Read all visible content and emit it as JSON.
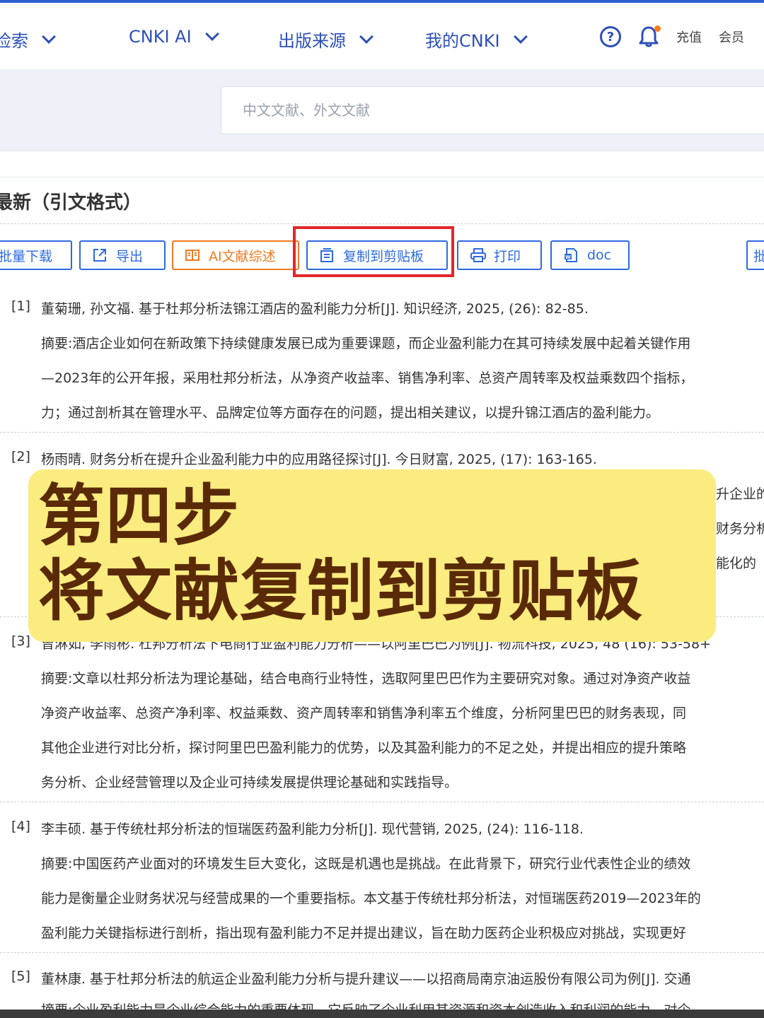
{
  "nav": {
    "items": [
      {
        "label": "检索"
      },
      {
        "label": "CNKI AI"
      },
      {
        "label": "出版来源"
      },
      {
        "label": "我的CNKI"
      }
    ],
    "help": "?",
    "recharge": "充值",
    "member": "会员"
  },
  "search": {
    "placeholder": "中文文献、外文文献"
  },
  "section": {
    "title": "最新（引文格式）"
  },
  "toolbar": {
    "batch_download": "批量下载",
    "export": "导出",
    "ai_review": "AI文献综述",
    "copy_clipboard": "复制到剪贴板",
    "print": "打印",
    "doc": "doc",
    "more": "批"
  },
  "references": [
    {
      "num": "[1]",
      "title": "董菊珊, 孙文福. 基于杜邦分析法锦江酒店的盈利能力分析[J]. 知识经济, 2025, (26): 82-85.",
      "abstract": [
        "摘要:酒店企业如何在新政策下持续健康发展已成为重要课题，而企业盈利能力在其可持续发展中起着关键作用",
        "—2023年的公开年报，采用杜邦分析法，从净资产收益率、销售净利率、总资产周转率及权益乘数四个指标，",
        "力；通过剖析其在管理水平、品牌定位等方面存在的问题，提出相关建议，以提升锦江酒店的盈利能力。"
      ]
    },
    {
      "num": "[2]",
      "title": "杨雨晴. 财务分析在提升企业盈利能力中的应用路径探讨[J]. 今日财富, 2025, (17): 163-165.",
      "abstract": [
        "升企业的",
        "财务分析",
        "能化的"
      ]
    },
    {
      "num": "[3]",
      "title": "曾淋如, 李雨彬. 杜邦分析法下电商行业盈利能力分析——以阿里巴巴为例[J]. 物流科技, 2025, 48 (16): 53-58+",
      "abstract": [
        "摘要:文章以杜邦分析法为理论基础，结合电商行业特性，选取阿里巴巴作为主要研究对象。通过对净资产收益",
        "净资产收益率、总资产净利率、权益乘数、资产周转率和销售净利率五个维度，分析阿里巴巴的财务表现，同",
        "其他企业进行对比分析，探讨阿里巴巴盈利能力的优势，以及其盈利能力的不足之处，并提出相应的提升策略",
        "务分析、企业经营管理以及企业可持续发展提供理论基础和实践指导。"
      ]
    },
    {
      "num": "[4]",
      "title": "李丰硕. 基于传统杜邦分析法的恒瑞医药盈利能力分析[J]. 现代营销, 2025, (24): 116-118.",
      "abstract": [
        "摘要:中国医药产业面对的环境发生巨大变化，这既是机遇也是挑战。在此背景下，研究行业代表性企业的绩效",
        "能力是衡量企业财务状况与经营成果的一个重要指标。本文基于传统杜邦分析法，对恒瑞医药2019—2023年的",
        "盈利能力关键指标进行剖析，指出现有盈利能力不足并提出建议，旨在助力医药企业积极应对挑战，实现更好"
      ]
    },
    {
      "num": "[5]",
      "title": "董林康. 基于杜邦分析法的航运企业盈利能力分析与提升建议——以招商局南京油运股份有限公司为例[J]. 交通",
      "abstract": [
        "摘要:企业盈利能力是企业综合能力的重要体现，它反映了企业利用其资源和资本创造收入和利润的能力，对企"
      ]
    }
  ],
  "overlay": {
    "line1": "第四步",
    "line2": "将文献复制到剪贴板"
  },
  "colors": {
    "brand_blue": "#2d6ae0",
    "ai_orange": "#f07b23",
    "highlight_red": "#e3262a",
    "overlay_bg": "#fbec7f",
    "overlay_text": "#5a2a08"
  }
}
